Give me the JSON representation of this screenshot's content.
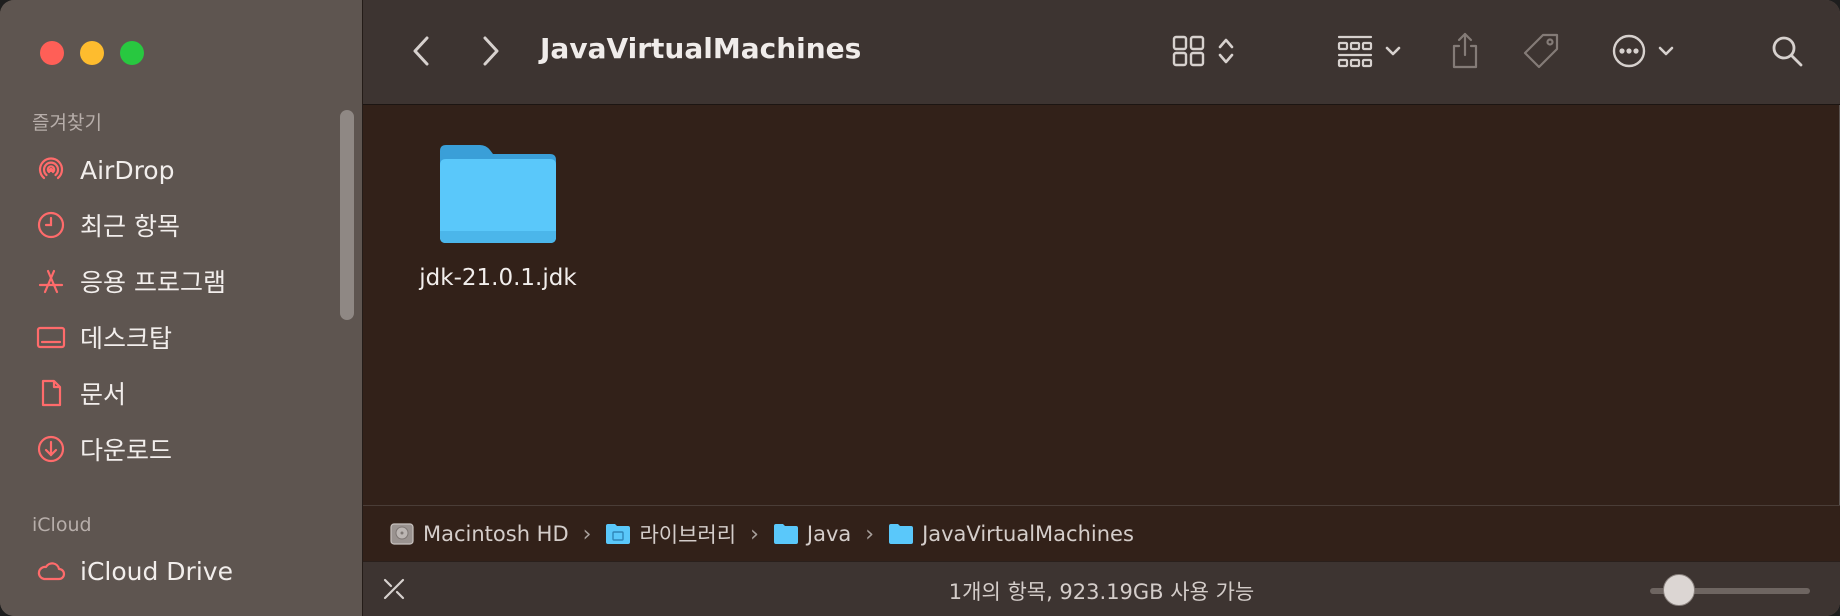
{
  "window": {
    "title": "JavaVirtualMachines"
  },
  "sidebar": {
    "favorites_header": "즐겨찾기",
    "favorites": [
      {
        "label": "AirDrop",
        "icon": "airdrop-icon"
      },
      {
        "label": "최근 항목",
        "icon": "clock-icon"
      },
      {
        "label": "응용 프로그램",
        "icon": "applications-icon"
      },
      {
        "label": "데스크탑",
        "icon": "desktop-icon"
      },
      {
        "label": "문서",
        "icon": "document-icon"
      },
      {
        "label": "다운로드",
        "icon": "download-icon"
      }
    ],
    "icloud_header": "iCloud",
    "icloud": [
      {
        "label": "iCloud Drive",
        "icon": "cloud-icon"
      }
    ]
  },
  "content": {
    "items": [
      {
        "name": "jdk-21.0.1.jdk",
        "kind": "folder"
      }
    ]
  },
  "pathbar": {
    "crumbs": [
      "Macintosh HD",
      "라이브러리",
      "Java",
      "JavaVirtualMachines"
    ],
    "separator": "›"
  },
  "status": {
    "text": "1개의 항목, 923.19GB 사용 가능"
  },
  "colors": {
    "accent": "#ff6b6b",
    "folder": "#5ac8fa"
  }
}
